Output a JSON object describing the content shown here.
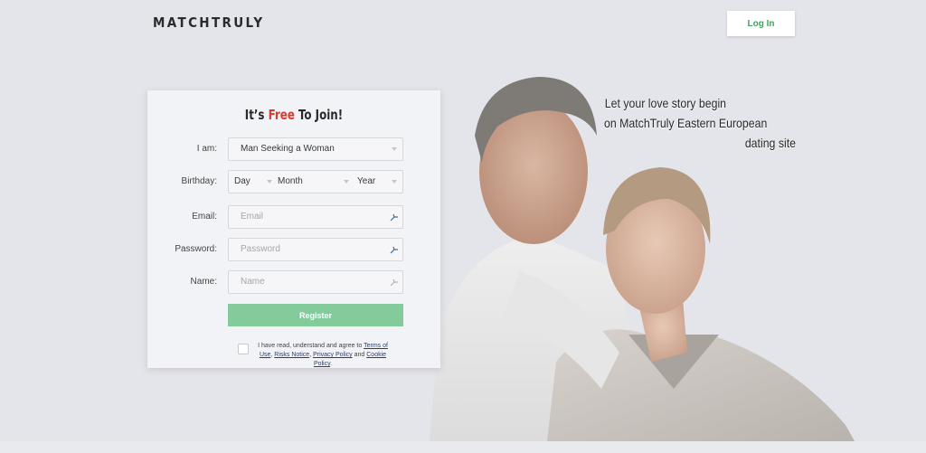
{
  "header": {
    "logo": "MATCHTRULY",
    "login_label": "Log In",
    "accent_color": "#3fa35c"
  },
  "hero": {
    "tagline": [
      "Let your love story begin",
      "on MatchTruly Eastern European",
      "dating site"
    ],
    "image": "couple-embracing-photo"
  },
  "form": {
    "title_prefix": "It’s",
    "title_highlight": "Free",
    "title_suffix": "To Join!",
    "highlight_color": "#d83b2f",
    "fields": {
      "iam": {
        "label": "I am:",
        "value": "Man Seeking a Woman"
      },
      "birthday": {
        "label": "Birthday:",
        "day": "Day",
        "month": "Month",
        "year": "Year"
      },
      "email": {
        "label": "Email:",
        "placeholder": "Email"
      },
      "password": {
        "label": "Password:",
        "placeholder": "Password"
      },
      "name": {
        "label": "Name:",
        "placeholder": "Name"
      }
    },
    "register_label": "Register",
    "register_color": "#84cb9b",
    "terms": {
      "checked": false,
      "text_before": "I have read, understand and agree to",
      "terms_of_use": "Terms of Use",
      "risks_notice": "Risks Notice",
      "privacy_policy": "Privacy Policy",
      "and": "and",
      "cookie_policy": "Cookie Policy"
    }
  }
}
